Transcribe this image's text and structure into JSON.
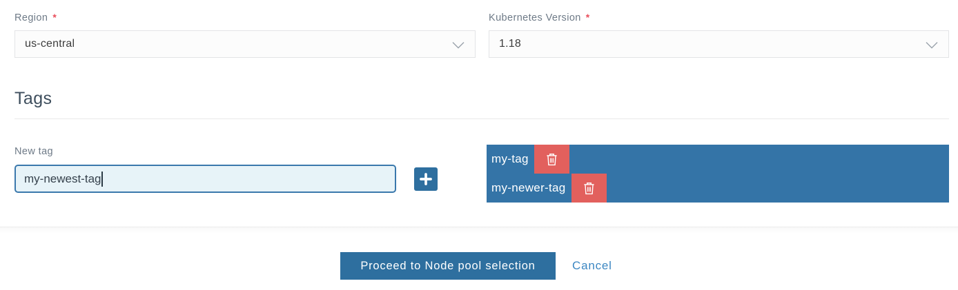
{
  "fields": [
    {
      "label": "Region",
      "required_marker": "*",
      "value": "us-central"
    },
    {
      "label": "Kubernetes Version",
      "required_marker": "*",
      "value": "1.18"
    }
  ],
  "tags_section": {
    "heading": "Tags",
    "new_tag_label": "New tag",
    "new_tag_value": "my-newest-tag",
    "tags": [
      {
        "name": "my-tag"
      },
      {
        "name": "my-newer-tag"
      }
    ]
  },
  "footer": {
    "proceed_label": "Proceed to Node pool selection",
    "cancel_label": "Cancel"
  },
  "icons": {
    "add": "plus-icon",
    "delete": "trash-icon",
    "dropdown": "chevron-down-icon"
  },
  "colors": {
    "primary_blue": "#2e6f9f",
    "panel_blue": "#3474a7",
    "danger_red": "#e2605d",
    "focus_border_blue": "#3a78ac",
    "focus_bg_blue": "#e7f3f8",
    "label_gray": "#6e7a87",
    "asterisk_red": "#e94f5d",
    "link_blue": "#3c87c2"
  }
}
